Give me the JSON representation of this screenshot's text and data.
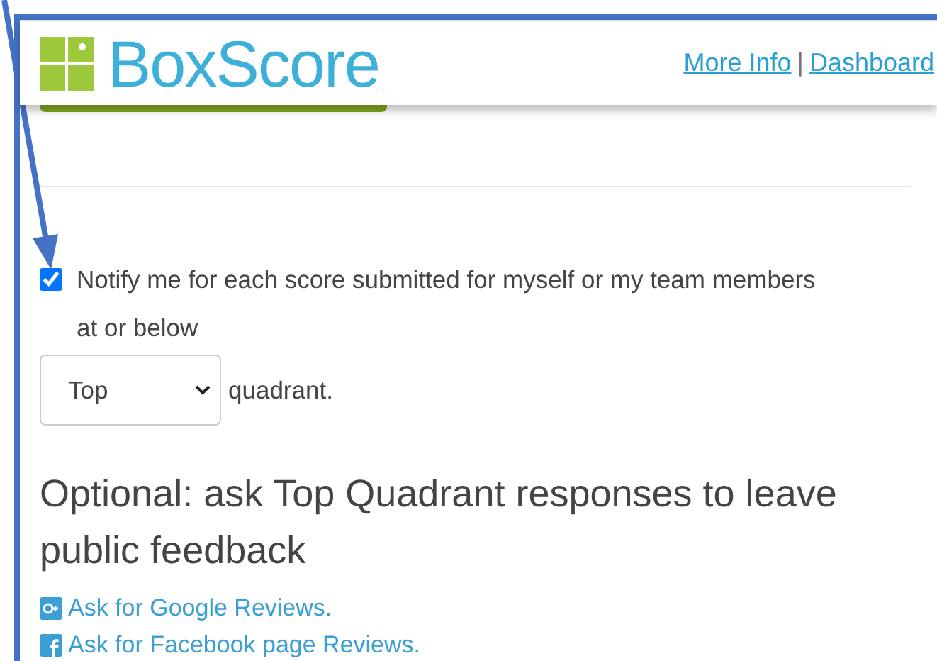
{
  "header": {
    "logo_text": "BoxScore",
    "links": [
      "More Info",
      "Dashboard"
    ],
    "separator": "|"
  },
  "notify": {
    "checked": true,
    "label": "Notify me for each score submitted for myself or my team members at or below",
    "select_value": "Top",
    "suffix": "quadrant."
  },
  "optional": {
    "heading": "Optional: ask Top Quadrant responses to leave public feedback",
    "links": [
      {
        "kind": "google",
        "text": "Ask for Google Reviews."
      },
      {
        "kind": "facebook",
        "text": "Ask for Facebook page Reviews."
      }
    ]
  }
}
